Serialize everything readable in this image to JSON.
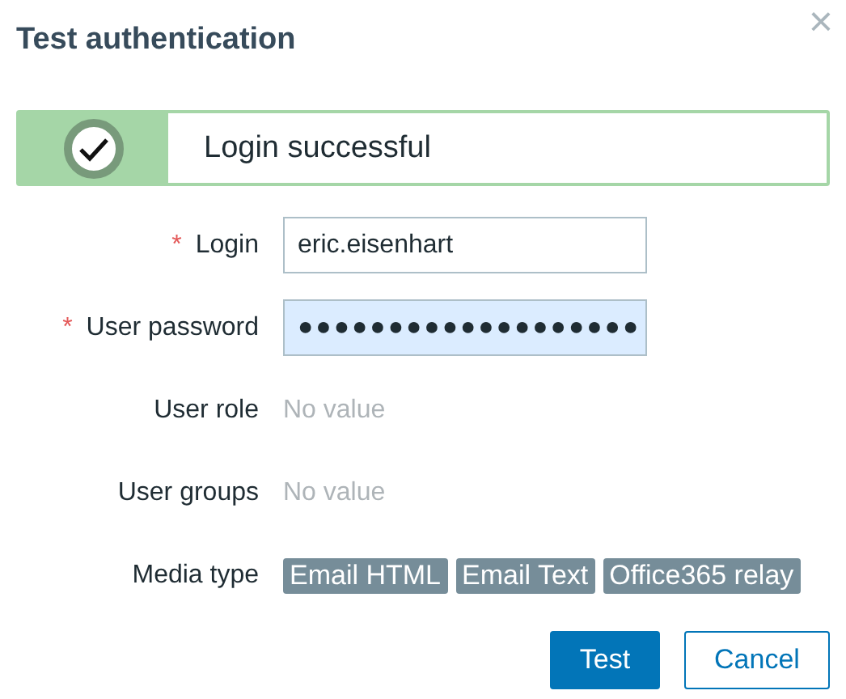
{
  "dialog": {
    "title": "Test authentication",
    "close": "×"
  },
  "message": {
    "kind": "success",
    "text": "Login successful"
  },
  "fields": [
    {
      "kind": "input",
      "label": "Login",
      "required": true,
      "focused": false,
      "value": "eric.eisenhart"
    },
    {
      "kind": "input",
      "label": "User password",
      "required": true,
      "focused": true,
      "value": "●●●●●●●●●●●●●●●●●●●"
    },
    {
      "kind": "empty",
      "label": "User role",
      "required": false,
      "value": "No value"
    },
    {
      "kind": "empty",
      "label": "User groups",
      "required": false,
      "value": "No value"
    },
    {
      "kind": "tags",
      "label": "Media type",
      "required": false,
      "tags": [
        "Email HTML",
        "Email Text",
        "Office365 relay"
      ]
    }
  ],
  "required_mark": "*",
  "buttons": [
    {
      "kind": "primary",
      "label": "Test"
    },
    {
      "kind": "secondary",
      "label": "Cancel"
    }
  ]
}
